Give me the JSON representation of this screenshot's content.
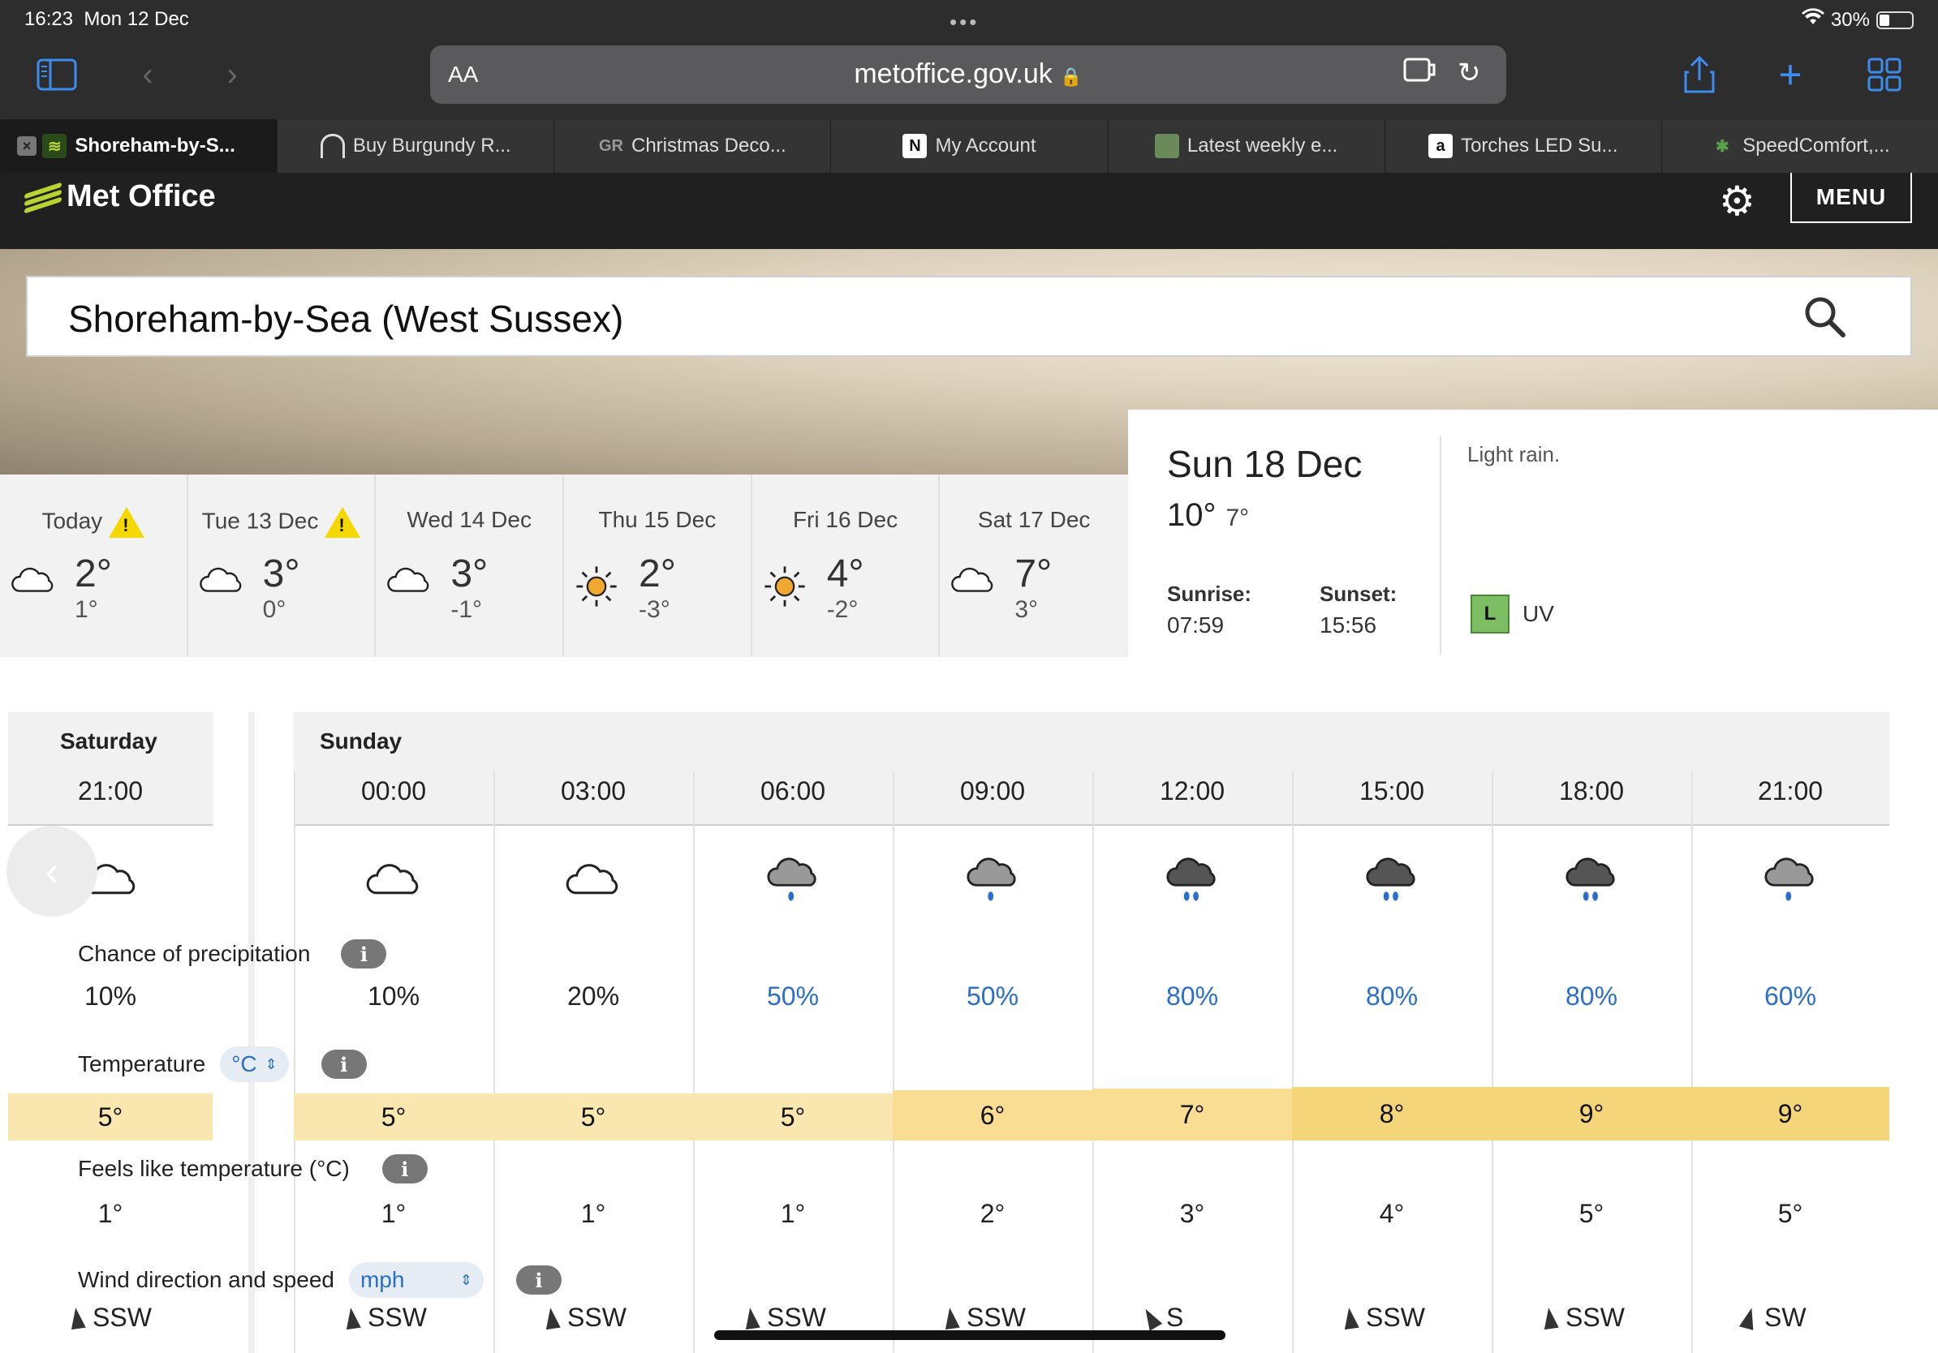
{
  "status": {
    "time": "16:23",
    "date": "Mon 12 Dec",
    "battery": "30%"
  },
  "browser": {
    "aa_label": "AA",
    "url": "metoffice.gov.uk",
    "tabs": [
      {
        "label": "Shoreham-by-S...",
        "active": true
      },
      {
        "label": "Buy Burgundy R..."
      },
      {
        "label": "Christmas Deco..."
      },
      {
        "label": "My Account"
      },
      {
        "label": "Latest weekly e..."
      },
      {
        "label": "Torches LED Su..."
      },
      {
        "label": "SpeedComfort,..."
      }
    ]
  },
  "site": {
    "logo": "Met Office",
    "menu_label": "MENU"
  },
  "search": {
    "location": "Shoreham-by-Sea (West Sussex)"
  },
  "days": [
    {
      "name": "Today",
      "warning": true,
      "icon": "cloud-icon",
      "max": "2°",
      "min": "1°"
    },
    {
      "name": "Tue 13 Dec",
      "warning": true,
      "icon": "cloud-icon",
      "max": "3°",
      "min": "0°"
    },
    {
      "name": "Wed 14 Dec",
      "warning": false,
      "icon": "cloud-icon",
      "max": "3°",
      "min": "-1°"
    },
    {
      "name": "Thu 15 Dec",
      "warning": false,
      "icon": "sun-icon",
      "max": "2°",
      "min": "-3°"
    },
    {
      "name": "Fri 16 Dec",
      "warning": false,
      "icon": "sun-icon",
      "max": "4°",
      "min": "-2°"
    },
    {
      "name": "Sat 17 Dec",
      "warning": false,
      "icon": "cloud-icon",
      "max": "7°",
      "min": "3°"
    }
  ],
  "detail": {
    "date": "Sun 18 Dec",
    "max": "10°",
    "min": "7°",
    "sunrise_label": "Sunrise:",
    "sunrise": "07:59",
    "sunset_label": "Sunset:",
    "sunset": "15:56",
    "description": "Light rain.",
    "uv_level": "L",
    "uv_label": "UV"
  },
  "hourly": {
    "day1": "Saturday",
    "day2": "Sunday",
    "labels": {
      "precip": "Chance of precipitation",
      "temperature": "Temperature",
      "temp_unit": "°C",
      "feels": "Feels like temperature (°C)",
      "wind": "Wind direction and speed",
      "wind_unit": "mph",
      "info": "i"
    },
    "columns": [
      {
        "time": "21:00",
        "icon": "cloud",
        "precip": "10%",
        "temp": "5°",
        "feels": "1°",
        "wind": "SSW",
        "wind_deg": 202
      },
      {
        "time": "00:00",
        "icon": "cloud",
        "precip": "10%",
        "temp": "5°",
        "feels": "1°",
        "wind": "SSW",
        "wind_deg": 202
      },
      {
        "time": "03:00",
        "icon": "cloud",
        "precip": "20%",
        "temp": "5°",
        "feels": "1°",
        "wind": "SSW",
        "wind_deg": 202
      },
      {
        "time": "06:00",
        "icon": "rain-light",
        "precip": "50%",
        "temp": "5°",
        "feels": "1°",
        "wind": "SSW",
        "wind_deg": 202
      },
      {
        "time": "09:00",
        "icon": "rain-light",
        "precip": "50%",
        "temp": "6°",
        "feels": "2°",
        "wind": "SSW",
        "wind_deg": 202
      },
      {
        "time": "12:00",
        "icon": "rain-heavy",
        "precip": "80%",
        "temp": "7°",
        "feels": "3°",
        "wind": "S",
        "wind_deg": 180
      },
      {
        "time": "15:00",
        "icon": "rain-heavy",
        "precip": "80%",
        "temp": "8°",
        "feels": "4°",
        "wind": "SSW",
        "wind_deg": 202
      },
      {
        "time": "18:00",
        "icon": "rain-heavy",
        "precip": "80%",
        "temp": "9°",
        "feels": "5°",
        "wind": "SSW",
        "wind_deg": 202
      },
      {
        "time": "21:00",
        "icon": "rain-light",
        "precip": "60%",
        "temp": "9°",
        "feels": "5°",
        "wind": "SW",
        "wind_deg": 225
      }
    ]
  },
  "colors": {
    "precip_high": "#2a6fc9",
    "precip_low": "#222222",
    "temp_cool": "#fae7b0",
    "temp_warm": "#f5d57a",
    "met_green": "#b7d433"
  }
}
